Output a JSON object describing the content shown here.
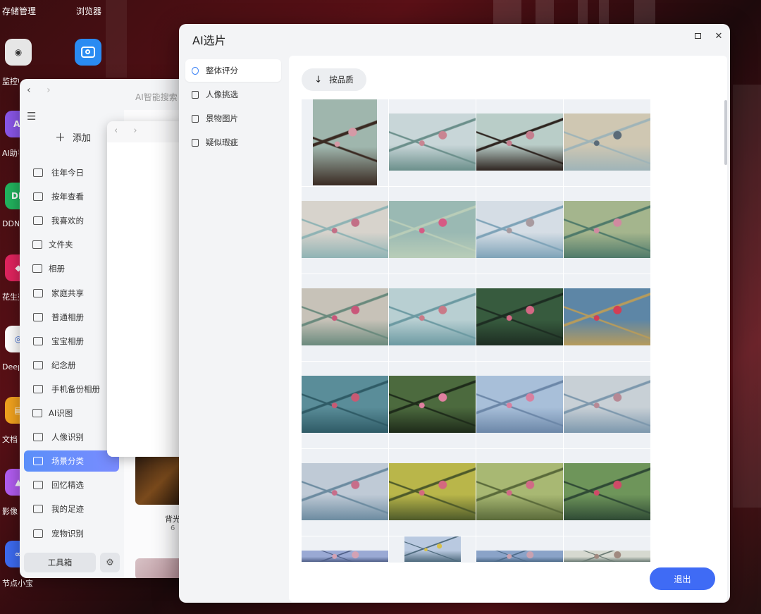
{
  "desktop": {
    "top_labels": [
      "存储管理",
      "浏览器"
    ],
    "icons": [
      {
        "label": "监控中心",
        "color": "#e6e6e6",
        "text_color": "#333",
        "glyph": "◉"
      },
      {
        "label": "AI助手",
        "color": "#8a56e8",
        "glyph": "AI"
      },
      {
        "label": "DDNS",
        "color": "#22b35e",
        "glyph": "DD"
      },
      {
        "label": "花生壳",
        "color": "#e0245e",
        "glyph": "◆"
      },
      {
        "label": "DeepSeek",
        "color": "#ffffff",
        "text_color": "#3566d6",
        "glyph": "◎"
      },
      {
        "label": "文档",
        "color": "#f2a21e",
        "glyph": "▤"
      },
      {
        "label": "影像",
        "color": "#b15cf0",
        "glyph": "▲"
      },
      {
        "label": "节点小宝",
        "color": "#3d6bf0",
        "glyph": "∞"
      }
    ],
    "browser_icon_color": "#2a8bf2"
  },
  "photo_app": {
    "nav_back": "‹",
    "nav_forward": "›",
    "search_placeholder": "AI智能搜索",
    "menu_icon": "☰",
    "add_label": "添加",
    "sidebar": [
      {
        "label": "往年今日",
        "icon": "calendar-icon"
      },
      {
        "label": "按年查看",
        "icon": "calendar-grid-icon"
      },
      {
        "label": "我喜欢的",
        "icon": "heart-image-icon"
      },
      {
        "label": "文件夹",
        "icon": "folder-icon",
        "top": true,
        "chevron": "›"
      },
      {
        "label": "相册",
        "icon": "album-icon",
        "top": true,
        "chevron": "⌄"
      },
      {
        "label": "家庭共享",
        "icon": "family-icon"
      },
      {
        "label": "普通相册",
        "icon": "image-icon"
      },
      {
        "label": "宝宝相册",
        "icon": "baby-icon"
      },
      {
        "label": "纪念册",
        "icon": "memorial-icon"
      },
      {
        "label": "手机备份相册",
        "icon": "phone-icon"
      },
      {
        "label": "AI识图",
        "icon": "ai-icon",
        "top": true,
        "chevron": "⌄"
      },
      {
        "label": "人像识别",
        "icon": "face-icon"
      },
      {
        "label": "场景分类",
        "icon": "scene-icon",
        "active": true
      },
      {
        "label": "回忆精选",
        "icon": "memory-icon"
      },
      {
        "label": "我的足迹",
        "icon": "footprint-icon"
      },
      {
        "label": "宠物识别",
        "icon": "pet-icon"
      }
    ],
    "toolbox_label": "工具箱",
    "settings_icon": "⚙",
    "album_caption": "背光",
    "album_count": "6"
  },
  "ai_window": {
    "title": "AI选片",
    "maximize_icon": "maximize-icon",
    "close_glyph": "✕",
    "nav": [
      {
        "label": "整体评分",
        "active": true
      },
      {
        "label": "人像挑选"
      },
      {
        "label": "景物图片"
      },
      {
        "label": "疑似瑕疵"
      }
    ],
    "sort_arrow": "↓",
    "sort_label": "按品质",
    "exit_label": "退出",
    "accent": "#3f6bf5"
  },
  "photos": [
    {
      "kind": "portrait",
      "a": "#9fb6ad",
      "b": "#d59aa6",
      "c": "#3a2a22"
    },
    {
      "kind": "landscape",
      "a": "#c8d6d8",
      "b": "#c98592",
      "c": "#6b8f8b"
    },
    {
      "kind": "landscape",
      "a": "#b9cdc8",
      "b": "#c47e8e",
      "c": "#2e2520"
    },
    {
      "kind": "landscape",
      "a": "#cfc7b2",
      "b": "#5b6b78",
      "c": "#9fb4b8"
    },
    {
      "kind": "landscape",
      "a": "#d7d3cc",
      "b": "#c26f86",
      "c": "#8fb3b4"
    },
    {
      "kind": "landscape",
      "a": "#9ab9b3",
      "b": "#d65a84",
      "c": "#b9cdb8"
    },
    {
      "kind": "landscape",
      "a": "#d5dde5",
      "b": "#a89a9f",
      "c": "#7ea3b8"
    },
    {
      "kind": "landscape",
      "a": "#a4b58d",
      "b": "#d08aa0",
      "c": "#4f7a6a"
    },
    {
      "kind": "landscape",
      "a": "#c7c2b8",
      "b": "#c9577a",
      "c": "#6a8a7d"
    },
    {
      "kind": "landscape",
      "a": "#b8cfd2",
      "b": "#c97a88",
      "c": "#6c9aa2"
    },
    {
      "kind": "landscape",
      "a": "#375b3e",
      "b": "#d46884",
      "c": "#1d2d22"
    },
    {
      "kind": "landscape",
      "a": "#5d86a6",
      "b": "#d23e55",
      "c": "#b69b5c"
    },
    {
      "kind": "landscape",
      "a": "#5a8d99",
      "b": "#c75a73",
      "c": "#2f5b66"
    },
    {
      "kind": "landscape",
      "a": "#4c6a3e",
      "b": "#e080a0",
      "c": "#1e2b1a"
    },
    {
      "kind": "landscape",
      "a": "#a8bfd9",
      "b": "#d880a0",
      "c": "#6c87a8"
    },
    {
      "kind": "landscape",
      "a": "#c8d0d6",
      "b": "#b78995",
      "c": "#7d98ad"
    },
    {
      "kind": "landscape",
      "a": "#bfcad6",
      "b": "#c76e8a",
      "c": "#6c8ba0"
    },
    {
      "kind": "landscape",
      "a": "#b9b64a",
      "b": "#d4697f",
      "c": "#4e5a2a"
    },
    {
      "kind": "landscape",
      "a": "#a8b873",
      "b": "#d06a86",
      "c": "#5a6a3a"
    },
    {
      "kind": "landscape",
      "a": "#6e955a",
      "b": "#cf4a68",
      "c": "#2f4a35"
    },
    {
      "kind": "landscape",
      "a": "#9aa9d4",
      "b": "#d3a2b4",
      "c": "#4f5f88"
    },
    {
      "kind": "portrait-small",
      "a": "#b9c9e0",
      "b": "#d7c04a",
      "c": "#4e6a7d"
    },
    {
      "kind": "landscape",
      "a": "#8aa3c8",
      "b": "#c9a1b0",
      "c": "#4e6b8a"
    },
    {
      "kind": "landscape",
      "a": "#d6d9d0",
      "b": "#a08a80",
      "c": "#6b7b74"
    }
  ]
}
